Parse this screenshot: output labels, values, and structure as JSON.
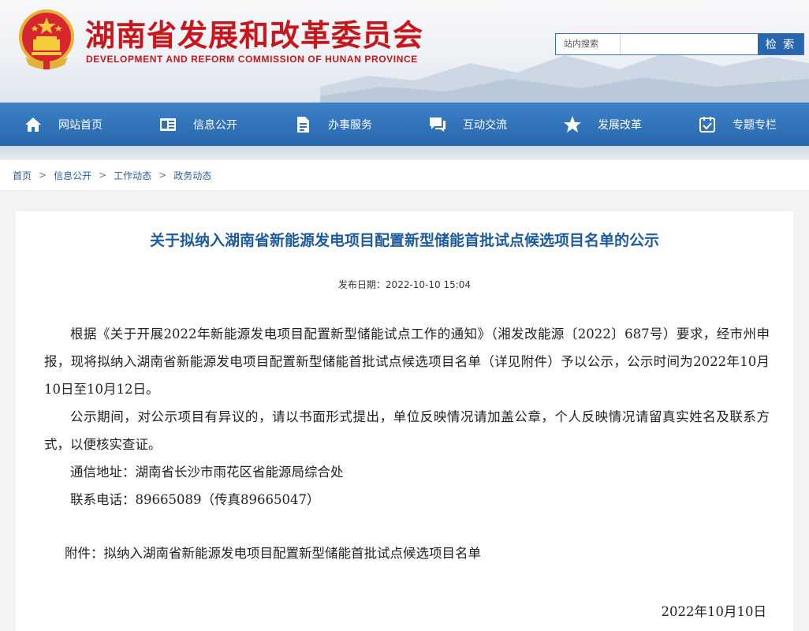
{
  "header": {
    "title": "湖南省发展和改革委员会",
    "subtitle": "DEVELOPMENT AND REFORM COMMISSION OF HUNAN PROVINCE",
    "search_label": "站内搜索",
    "search_value": "",
    "search_button": "检 索"
  },
  "nav": {
    "items": [
      {
        "label": "网站首页",
        "icon": "home-icon"
      },
      {
        "label": "信息公开",
        "icon": "info-card-icon"
      },
      {
        "label": "办事服务",
        "icon": "document-icon"
      },
      {
        "label": "互动交流",
        "icon": "chat-icon"
      },
      {
        "label": "发展改革",
        "icon": "star-icon"
      },
      {
        "label": "专题专栏",
        "icon": "calendar-check-icon"
      }
    ]
  },
  "breadcrumb": [
    "首页",
    "信息公开",
    "工作动态",
    "政务动态"
  ],
  "breadcrumb_sep": ">",
  "article": {
    "title": "关于拟纳入湖南省新能源发电项目配置新型储能首批试点候选项目名单的公示",
    "date": "发布日期：2022-10-10 15:04",
    "paragraphs": [
      "根据《关于开展2022年新能源发电项目配置新型储能试点工作的通知》（湘发改能源〔2022〕687号）要求，经市州申报，现将拟纳入湖南省新能源发电项目配置新型储能首批试点候选项目名单（详见附件）予以公示，公示时间为2022年10月10日至10月12日。",
      "公示期间，对公示项目有异议的，请以书面形式提出，单位反映情况请加盖公章，个人反映情况请留真实姓名及联系方式，以便核实查证。"
    ],
    "address": "通信地址：湖南省长沙市雨花区省能源局综合处",
    "phone": "联系电话：89665089（传真89665047）",
    "attachment": "附件：拟纳入湖南省新能源发电项目配置新型储能首批试点候选项目名单",
    "sign_date": "2022年10月10日"
  },
  "colors": {
    "brand_red": "#c8161d",
    "nav_blue": "#2a68ad",
    "title_blue": "#1f5b9c"
  }
}
